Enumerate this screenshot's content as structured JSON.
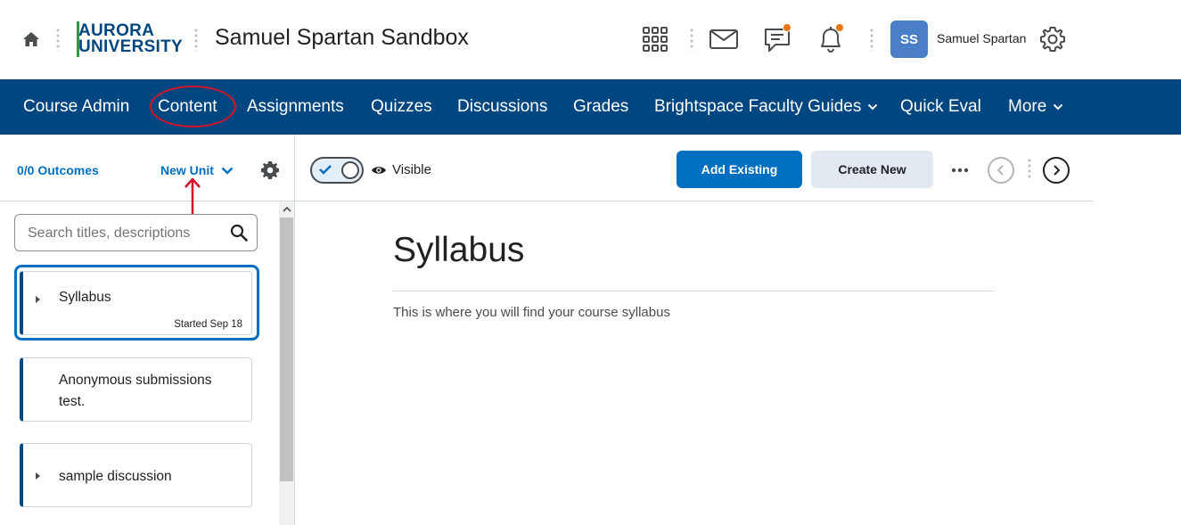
{
  "header": {
    "home_icon": "home-icon",
    "logo": {
      "line1": "AURORA",
      "line2": "UNIVERSITY"
    },
    "course_title": "Samuel Spartan Sandbox",
    "icons": [
      "waffle-grid-icon",
      "mail-icon",
      "chat-icon",
      "bell-icon",
      "gear-icon"
    ],
    "notification_dot_color": "#e87511",
    "avatar_initials": "SS",
    "avatar_color": "#4a7fc7",
    "user_name": "Samuel Spartan"
  },
  "nav": {
    "background": "#004680",
    "items": [
      {
        "label": "Course Admin"
      },
      {
        "label": "Content",
        "annotated": true
      },
      {
        "label": "Assignments"
      },
      {
        "label": "Quizzes"
      },
      {
        "label": "Discussions"
      },
      {
        "label": "Grades"
      },
      {
        "label": "Brightspace Faculty Guides",
        "dropdown": true
      },
      {
        "label": "Quick Eval"
      },
      {
        "label": "More",
        "dropdown": true
      }
    ]
  },
  "left_panel": {
    "outcomes_label": "0/0 Outcomes",
    "new_unit_label": "New Unit",
    "search_placeholder": "Search titles, descriptions",
    "units": [
      {
        "title": "Syllabus",
        "meta": "Started Sep 18",
        "selected": true,
        "expandable": true
      },
      {
        "title_line1": "Anonymous submissions",
        "title_line2": "test.",
        "expandable": false
      },
      {
        "title": "sample discussion",
        "expandable": true
      }
    ]
  },
  "toolbar": {
    "visibility_label": "Visible",
    "add_existing_label": "Add Existing",
    "create_new_label": "Create New",
    "primary_color": "#006fbf"
  },
  "content": {
    "title": "Syllabus",
    "description": "This is where you will find your course syllabus"
  },
  "annotation_color": "#d6142a"
}
